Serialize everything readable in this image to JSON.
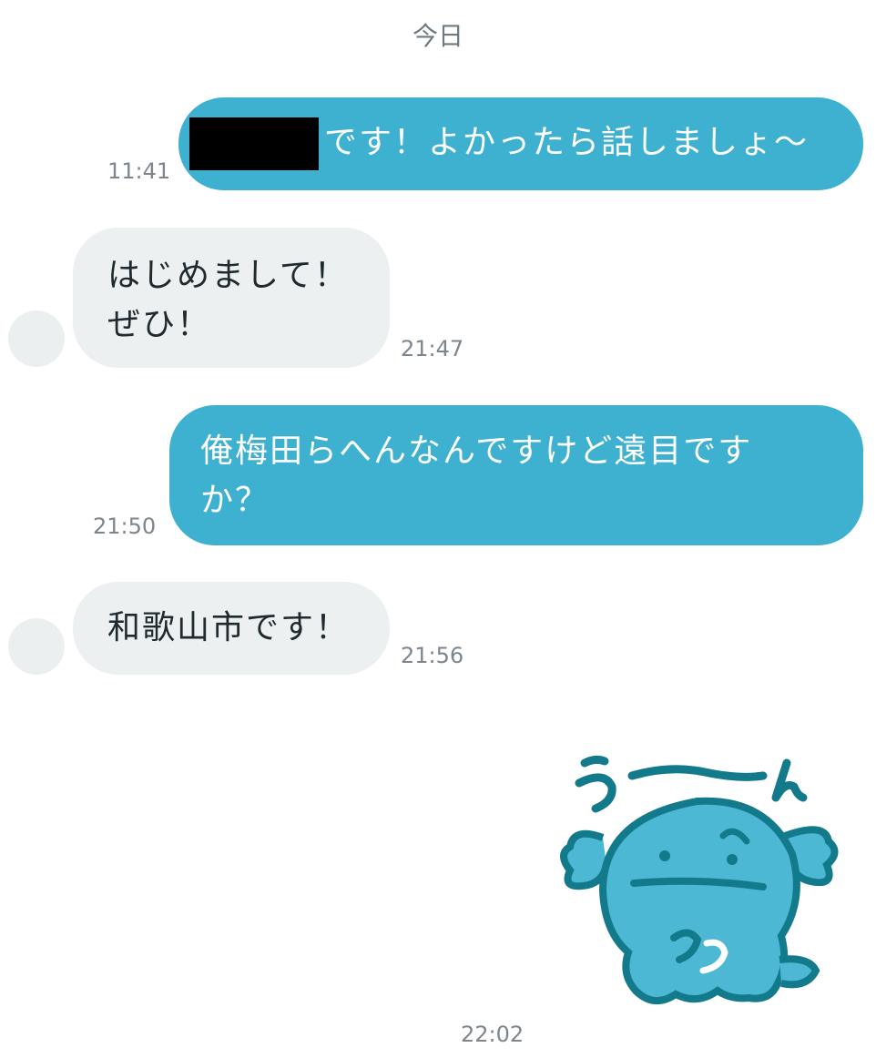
{
  "header": {
    "date_label": "今日"
  },
  "messages": [
    {
      "direction": "out",
      "text": "です！よかったら話しましょ〜",
      "time": "11:41",
      "has_redaction": true
    },
    {
      "direction": "in",
      "line1": "はじめまして！",
      "line2": "ぜひ！",
      "time": "21:47"
    },
    {
      "direction": "out",
      "line1": "俺梅田らへんなんですけど遠目ですか",
      "line1b": "か？",
      "line2": "か？",
      "time": "21:50"
    },
    {
      "direction": "in",
      "text": "和歌山市です！",
      "time": "21:56"
    },
    {
      "direction": "out",
      "type": "sticker",
      "sticker_text": "うーーん",
      "time": "22:02"
    }
  ],
  "colors": {
    "outgoing_bubble": "#3eb0d0",
    "incoming_bubble": "#ecf0f1",
    "sticker_body": "#4cb8d4",
    "sticker_outline": "#137a8c"
  }
}
